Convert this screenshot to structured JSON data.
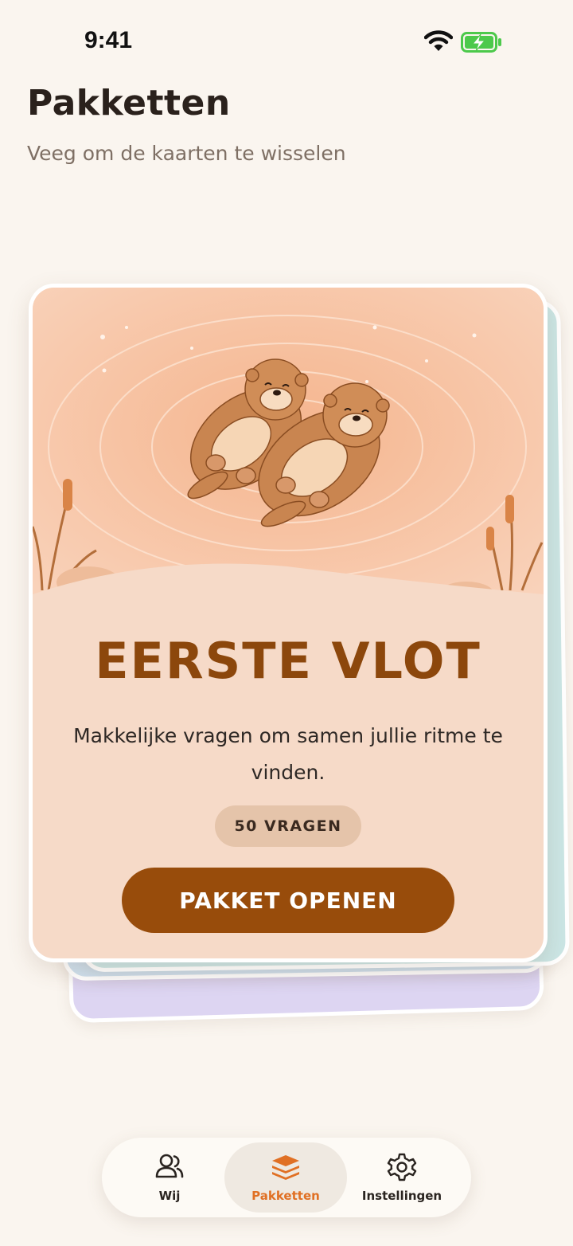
{
  "status_bar": {
    "time": "9:41",
    "icons": [
      "wifi-icon",
      "battery-charging-icon"
    ]
  },
  "header": {
    "title": "Pakketten",
    "subtitle": "Veeg om de kaarten te wisselen"
  },
  "pack": {
    "title": "EERSTE VLOT",
    "description": "Makkelijke vragen om samen jullie ritme te vinden.",
    "count_label": "50 VRAGEN",
    "open_button": "PAKKET OPENEN"
  },
  "tab_bar": {
    "items": [
      {
        "label": "Wij",
        "icon": "people-icon",
        "active": false
      },
      {
        "label": "Pakketten",
        "icon": "stack-icon",
        "active": true
      },
      {
        "label": "Instellingen",
        "icon": "gear-icon",
        "active": false
      }
    ]
  },
  "colors": {
    "background": "#faf5ef",
    "card": "#f6dac8",
    "accent": "#984c0b",
    "active_tab": "#e07024",
    "battery": "#4cc94b"
  }
}
